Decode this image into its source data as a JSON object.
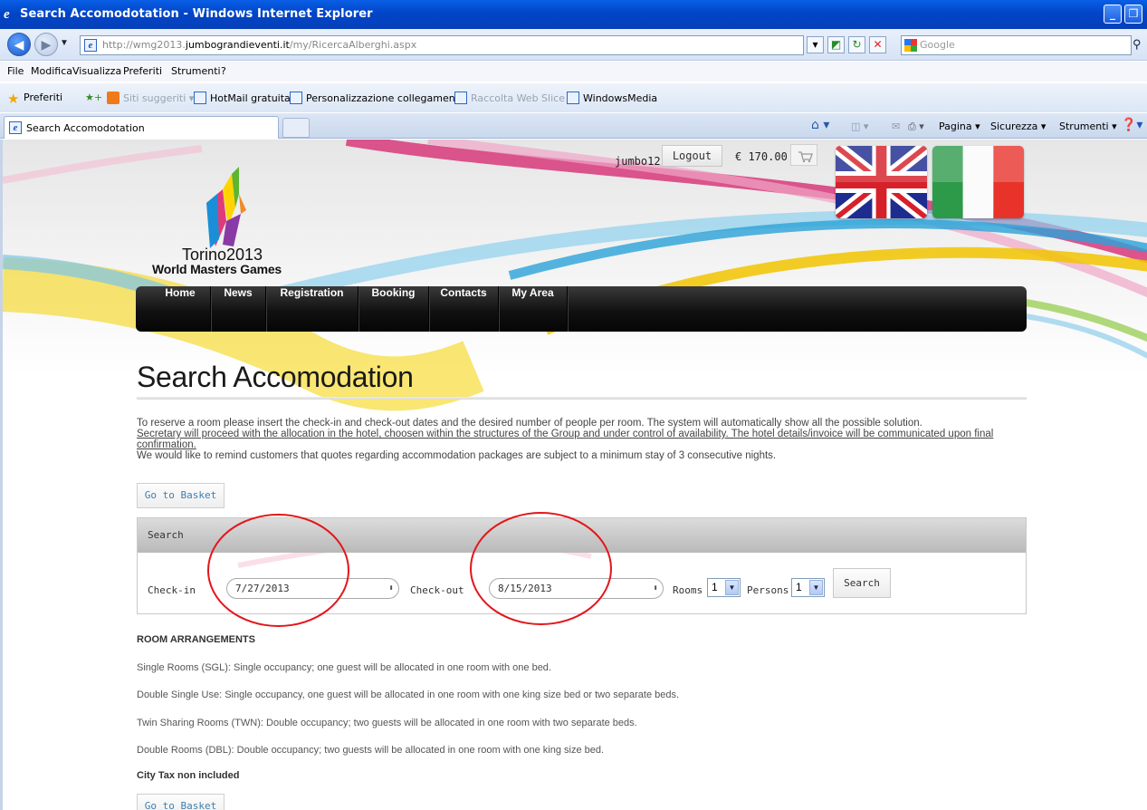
{
  "window": {
    "title": "Search Accomodotation - Windows Internet Explorer"
  },
  "address": {
    "url_prefix": "http://wmg2013.",
    "url_domain": "jumbograndieventi.it",
    "url_path": "/my/RicercaAlberghi.aspx",
    "search_placeholder": "Google"
  },
  "menu": [
    "File",
    "Modifica",
    "Visualizza",
    "Preferiti",
    "Strumenti",
    "?"
  ],
  "favorites": {
    "label": "Preferiti",
    "items": [
      "Siti suggeriti ▾",
      "HotMail gratuita",
      "Personalizzazione collegamenti",
      "Raccolta Web Slice ▾",
      "WindowsMedia"
    ]
  },
  "tab": {
    "title": "Search Accomodotation"
  },
  "commandbar": {
    "pagina": "Pagina ▾",
    "sicurezza": "Sicurezza ▾",
    "strumenti": "Strumenti ▾"
  },
  "site": {
    "logo_line1": "Torino2013",
    "logo_line2": "World Masters Games",
    "username": "jumbo12",
    "logout": "Logout",
    "amount": "€ 170.00",
    "nav": [
      "Home",
      "News",
      "Registration",
      "Booking",
      "Contacts",
      "My Area"
    ]
  },
  "content": {
    "heading": "Search Accomodation",
    "intro1": "To reserve a room please insert the check-in and check-out dates and the desired number of people per room. The system will automatically show all the possible solution.",
    "intro2": "Secretary will proceed with the allocation in the hotel, choosen within the structures of the Group and under control of availability. The hotel details/invoice will be communicated upon final confirmation.",
    "intro3": "We would like to remind customers that quotes regarding accommodation packages are subject to a minimum stay of 3 consecutive nights.",
    "basket_button": "Go to Basket",
    "search": {
      "header": "Search",
      "checkin_label": "Check-in",
      "checkin_value": "7/27/2013",
      "checkout_label": "Check-out",
      "checkout_value": "8/15/2013",
      "rooms_label": "Rooms",
      "rooms_value": "1",
      "persons_label": "Persons",
      "persons_value": "1",
      "search_button": "Search"
    },
    "arrangements": {
      "title": "ROOM ARRANGEMENTS",
      "items": [
        "Single Rooms (SGL): Single occupancy; one guest will be allocated in one room with one bed.",
        "Double Single Use: Single occupancy, one guest will be allocated in one room with one king size bed or two separate beds.",
        "Twin Sharing Rooms (TWN): Double occupancy; two guests will be allocated in one room with two separate beds.",
        "Double Rooms (DBL): Double occupancy; two guests will be allocated in one room with one king size bed."
      ],
      "tax_note": "City Tax non included"
    }
  },
  "colors": {
    "annotation_circle": "#e3161b",
    "title_bar": "#0145c8",
    "link_blue": "#3d7fb0"
  }
}
